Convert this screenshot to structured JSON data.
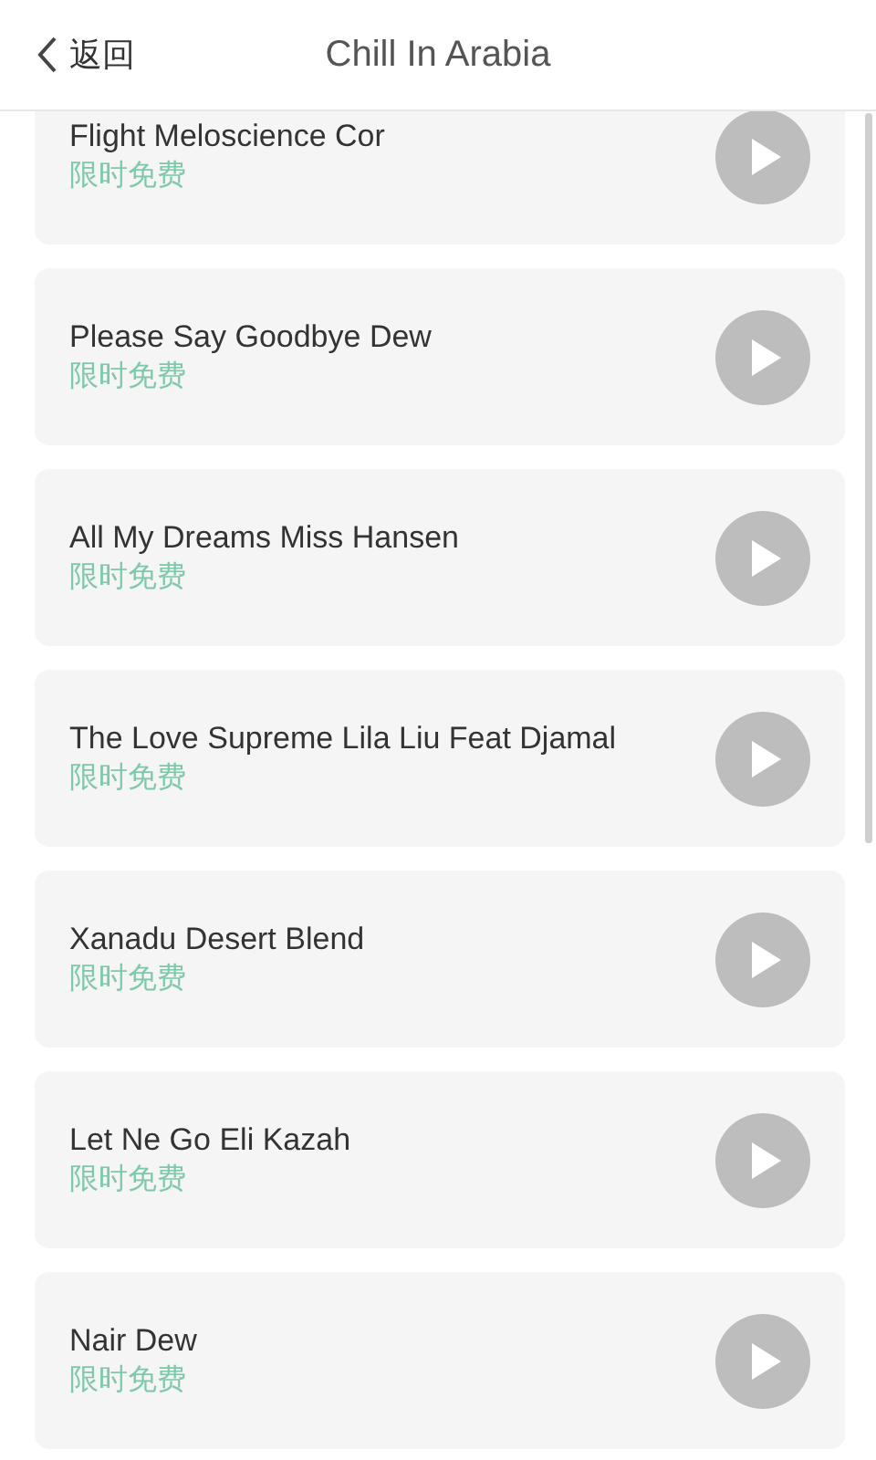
{
  "header": {
    "back_label": "返回",
    "title": "Chill In Arabia"
  },
  "tracks": [
    {
      "title": "Flight Meloscience Cor",
      "tag": "限时免费"
    },
    {
      "title": "Please Say Goodbye Dew",
      "tag": "限时免费"
    },
    {
      "title": "All My Dreams Miss Hansen",
      "tag": "限时免费"
    },
    {
      "title": "The Love Supreme Lila Liu Feat Djamal",
      "tag": "限时免费"
    },
    {
      "title": "Xanadu Desert Blend",
      "tag": "限时免费"
    },
    {
      "title": "Let Ne Go Eli Kazah",
      "tag": "限时免费"
    },
    {
      "title": "Nair Dew",
      "tag": "限时免费"
    }
  ]
}
